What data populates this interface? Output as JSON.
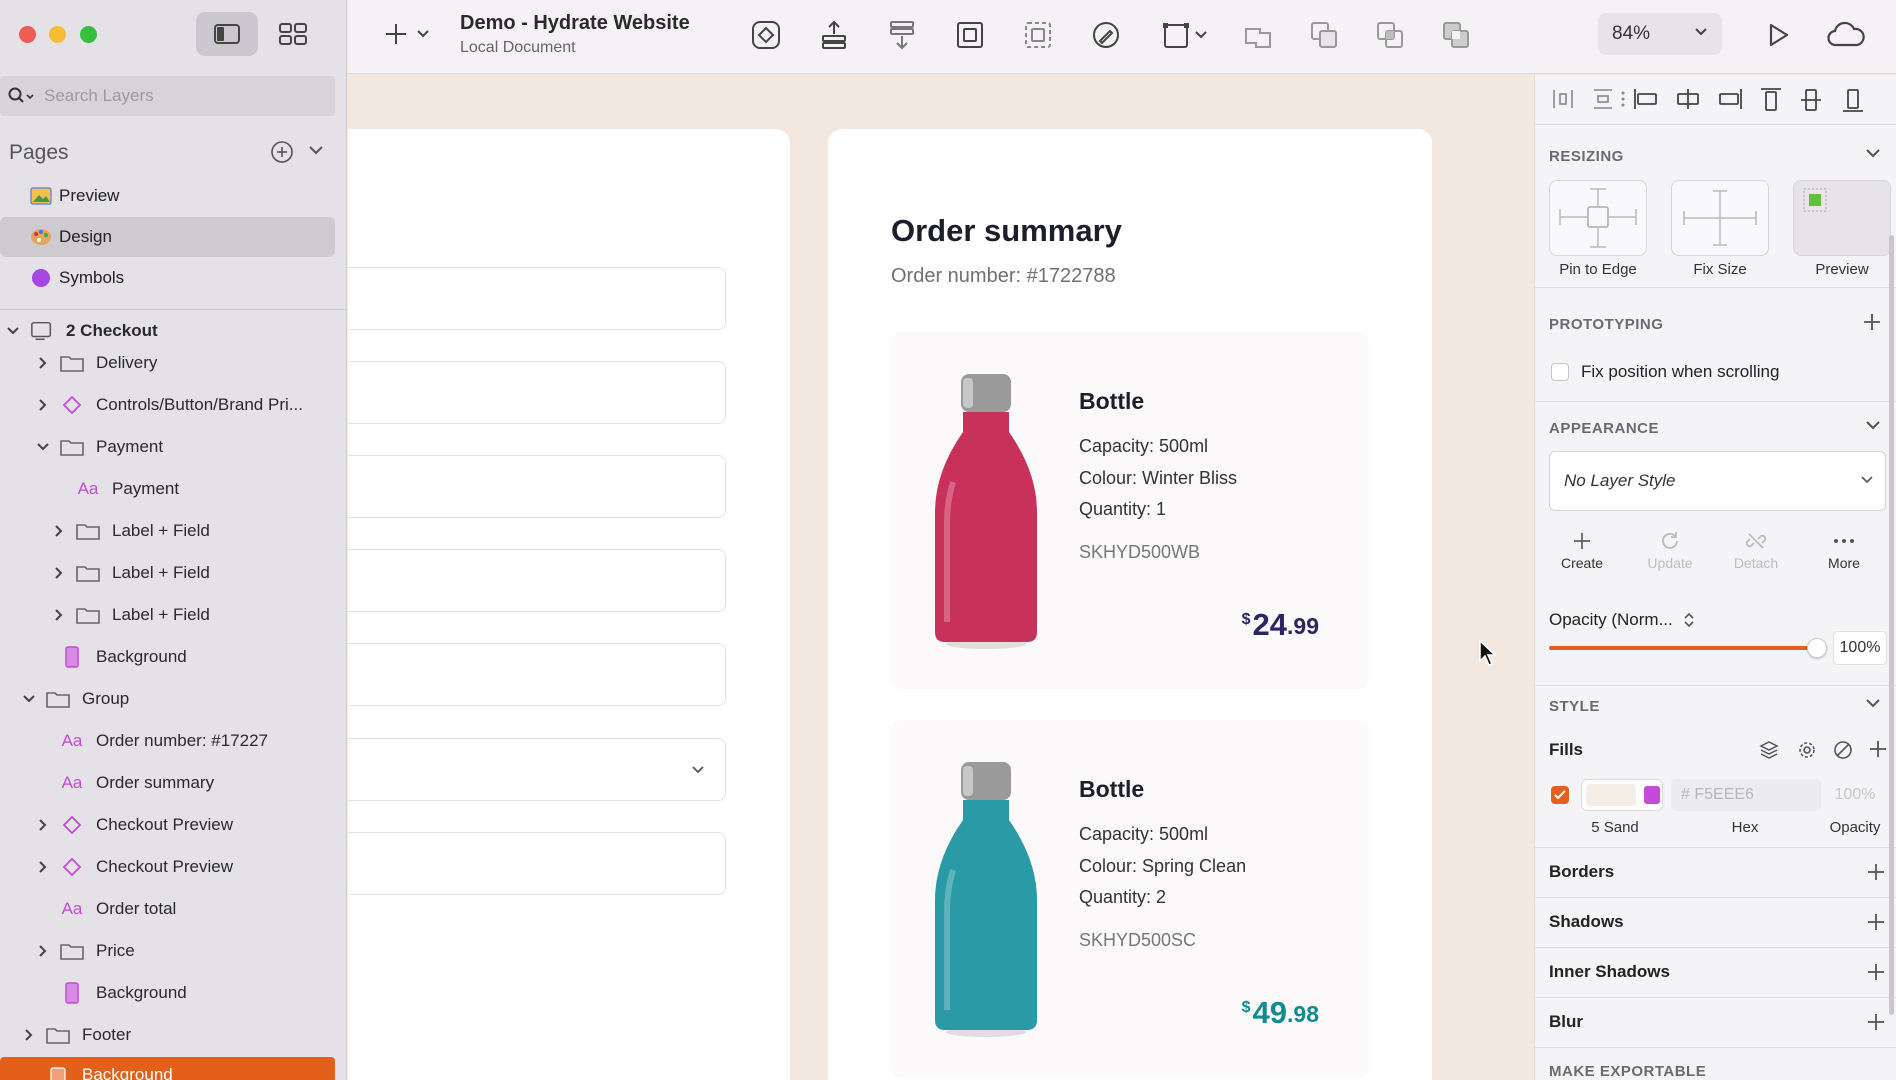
{
  "window": {
    "title": "Demo - Hydrate Website",
    "subtitle": "Local Document"
  },
  "sidebar": {
    "search": {
      "placeholder": "Search Layers"
    },
    "pages_title": "Pages",
    "pages": [
      {
        "label": "Preview",
        "icon": "image-icon"
      },
      {
        "label": "Design",
        "icon": "palette-icon",
        "selected": true
      },
      {
        "label": "Symbols",
        "icon": "symbols-icon"
      }
    ],
    "layers": [
      {
        "label": "2 Checkout",
        "type": "artboard"
      },
      {
        "label": "Delivery",
        "type": "folder"
      },
      {
        "label": "Controls/Button/Brand Pri...",
        "type": "symbol"
      },
      {
        "label": "Payment",
        "type": "folder"
      },
      {
        "label": "Payment",
        "type": "text"
      },
      {
        "label": "Label + Field",
        "type": "folder"
      },
      {
        "label": "Label + Field",
        "type": "folder"
      },
      {
        "label": "Label + Field",
        "type": "folder"
      },
      {
        "label": "Background",
        "type": "rectangle"
      },
      {
        "label": "Group",
        "type": "folder"
      },
      {
        "label": "Order number: #17227",
        "type": "text"
      },
      {
        "label": "Order summary",
        "type": "text"
      },
      {
        "label": "Checkout Preview",
        "type": "symbol"
      },
      {
        "label": "Checkout Preview",
        "type": "symbol"
      },
      {
        "label": "Order total",
        "type": "text"
      },
      {
        "label": "Price",
        "type": "folder"
      },
      {
        "label": "Background",
        "type": "rectangle"
      },
      {
        "label": "Footer",
        "type": "folder"
      },
      {
        "label": "Background",
        "type": "rectangle"
      }
    ]
  },
  "toolbar": {
    "zoom": "84%"
  },
  "canvas": {
    "order": {
      "title": "Order summary",
      "number": "Order number: #1722788",
      "products": [
        {
          "name": "Bottle",
          "capacity": "Capacity: 500ml",
          "colour": "Colour: Winter Bliss",
          "quantity": "Quantity: 1",
          "sku": "SKHYD500WB",
          "currency": "$",
          "price_int": "24",
          "price_dec": ".99",
          "price_color": "#2b2565",
          "bottle_color": "#c8325a"
        },
        {
          "name": "Bottle",
          "capacity": "Capacity: 500ml",
          "colour": "Colour: Spring Clean",
          "quantity": "Quantity: 2",
          "sku": "SKHYD500SC",
          "currency": "$",
          "price_int": "49",
          "price_dec": ".98",
          "price_color": "#138a8f",
          "bottle_color": "#2a9aa6"
        }
      ]
    }
  },
  "inspector": {
    "resizing": {
      "title": "RESIZING",
      "tiles": [
        "Pin to Edge",
        "Fix Size",
        "Preview"
      ]
    },
    "prototyping": {
      "title": "PROTOTYPING",
      "fix_position": "Fix position when scrolling"
    },
    "appearance": {
      "title": "APPEARANCE",
      "layer_style": "No Layer Style",
      "buttons": [
        {
          "label": "Create",
          "enabled": true
        },
        {
          "label": "Update",
          "enabled": false
        },
        {
          "label": "Detach",
          "enabled": false
        },
        {
          "label": "More",
          "enabled": true
        }
      ],
      "opacity_label": "Opacity (Norm...",
      "opacity_value": "100%",
      "opacity_fraction": 1.0
    },
    "style": {
      "title": "STYLE",
      "fills_label": "Fills",
      "fill": {
        "token_name": "5 Sand",
        "hex": "# F5EEE6",
        "opacity": "100%",
        "color": "#f5eee6",
        "hex_label": "Hex",
        "opacity_label": "Opacity"
      },
      "borders": "Borders",
      "shadows": "Shadows",
      "inner_shadows": "Inner Shadows",
      "blur": "Blur"
    },
    "export": {
      "title": "MAKE EXPORTABLE"
    }
  },
  "colors": {
    "accent": "#e5601c",
    "symbol": "#c64ad8"
  }
}
